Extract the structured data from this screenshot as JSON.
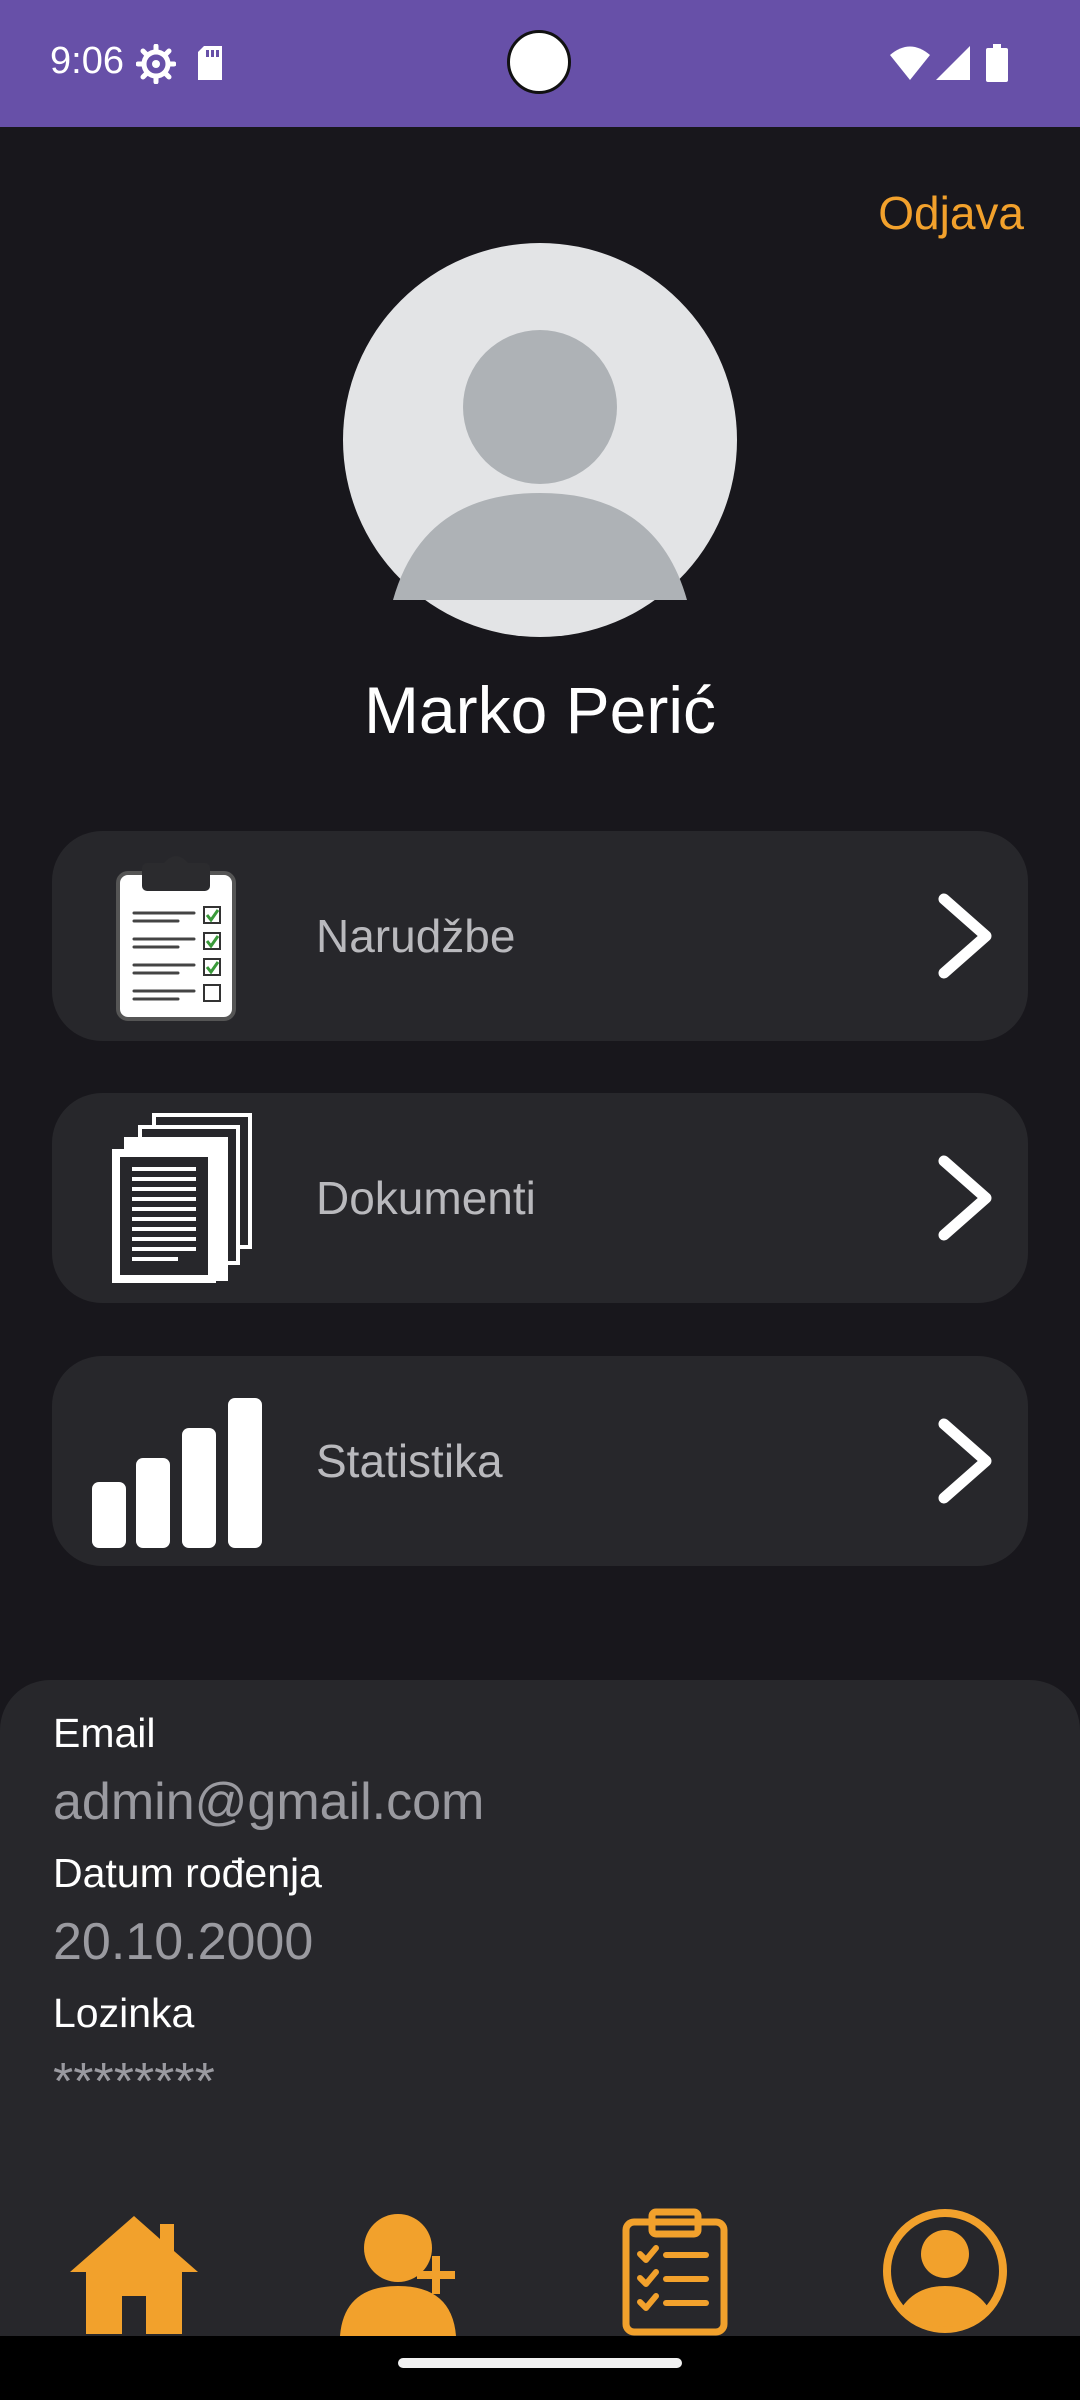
{
  "status_bar": {
    "time": "9:06"
  },
  "header": {
    "logout_label": "Odjava"
  },
  "profile": {
    "name": "Marko Perić"
  },
  "menu": {
    "orders_label": "Narudžbe",
    "documents_label": "Dokumenti",
    "statistics_label": "Statistika"
  },
  "info": {
    "email_label": "Email",
    "email_value": "admin@gmail.com",
    "dob_label": "Datum rođenja",
    "dob_value": "20.10.2000",
    "password_label": "Lozinka",
    "password_value": "********"
  },
  "bottom_nav": {
    "items": [
      {
        "icon": "home-icon"
      },
      {
        "icon": "add-user-icon"
      },
      {
        "icon": "clipboard-checklist-icon"
      },
      {
        "icon": "account-circle-icon"
      }
    ]
  },
  "colors": {
    "accent": "#f2a12c",
    "status_bar": "#6750a8",
    "background": "#18171c",
    "card": "#27272b"
  }
}
